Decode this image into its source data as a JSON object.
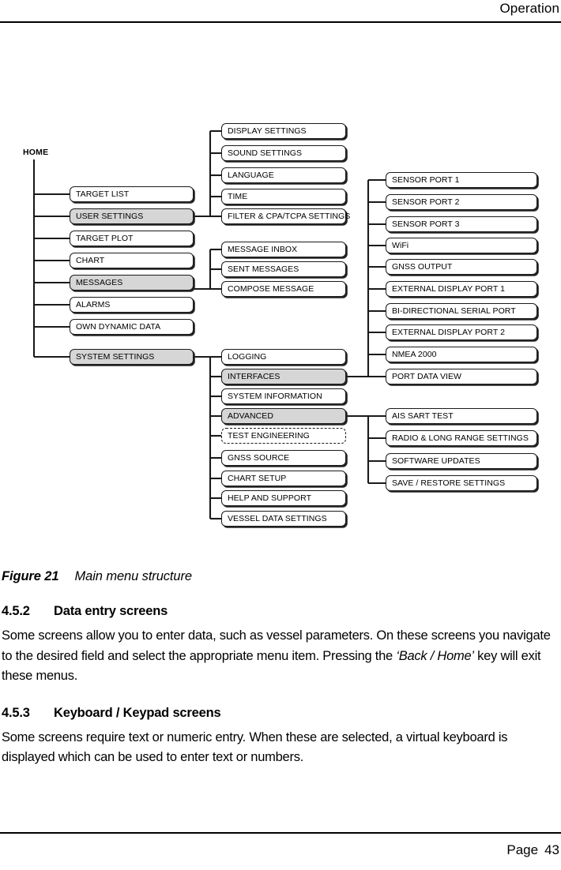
{
  "header": {
    "title": "Operation"
  },
  "footer": {
    "page_label": "Page",
    "page_number": "43"
  },
  "figure": {
    "label": "Figure 21",
    "title": "Main menu structure"
  },
  "diagram": {
    "root_label": "HOME",
    "columns": {
      "level1": [
        {
          "label": "TARGET LIST",
          "shaded": false
        },
        {
          "label": "USER SETTINGS",
          "shaded": true
        },
        {
          "label": "TARGET PLOT",
          "shaded": false
        },
        {
          "label": "CHART",
          "shaded": false
        },
        {
          "label": "MESSAGES",
          "shaded": true
        },
        {
          "label": "ALARMS",
          "shaded": false
        },
        {
          "label": "OWN DYNAMIC DATA",
          "shaded": false
        },
        {
          "label": "SYSTEM SETTINGS",
          "shaded": true
        }
      ],
      "user_settings_children": [
        {
          "label": "DISPLAY SETTINGS",
          "shaded": false
        },
        {
          "label": "SOUND SETTINGS",
          "shaded": false
        },
        {
          "label": "LANGUAGE",
          "shaded": false
        },
        {
          "label": "TIME",
          "shaded": false
        },
        {
          "label": "FILTER & CPA/TCPA SETTINGS",
          "shaded": false
        }
      ],
      "messages_children": [
        {
          "label": "MESSAGE INBOX",
          "shaded": false
        },
        {
          "label": "SENT MESSAGES",
          "shaded": false
        },
        {
          "label": "COMPOSE MESSAGE",
          "shaded": false
        }
      ],
      "system_settings_children": [
        {
          "label": "LOGGING",
          "shaded": false,
          "dashed": false
        },
        {
          "label": "INTERFACES",
          "shaded": true,
          "dashed": false
        },
        {
          "label": "SYSTEM INFORMATION",
          "shaded": false,
          "dashed": false
        },
        {
          "label": "ADVANCED",
          "shaded": true,
          "dashed": false
        },
        {
          "label": "TEST ENGINEERING",
          "shaded": false,
          "dashed": true
        },
        {
          "label": "GNSS SOURCE",
          "shaded": false,
          "dashed": false
        },
        {
          "label": "CHART SETUP",
          "shaded": false,
          "dashed": false
        },
        {
          "label": "HELP AND SUPPORT",
          "shaded": false,
          "dashed": false
        },
        {
          "label": "VESSEL DATA SETTINGS",
          "shaded": false,
          "dashed": false
        }
      ],
      "interfaces_children": [
        {
          "label": "SENSOR PORT 1",
          "shaded": false
        },
        {
          "label": "SENSOR PORT 2",
          "shaded": false
        },
        {
          "label": "SENSOR PORT 3",
          "shaded": false
        },
        {
          "label": "WiFi",
          "shaded": false
        },
        {
          "label": "GNSS OUTPUT",
          "shaded": false
        },
        {
          "label": "EXTERNAL DISPLAY PORT 1",
          "shaded": false
        },
        {
          "label": "BI-DIRECTIONAL SERIAL PORT",
          "shaded": false
        },
        {
          "label": "EXTERNAL DISPLAY PORT 2",
          "shaded": false
        },
        {
          "label": "NMEA 2000",
          "shaded": false
        },
        {
          "label": "PORT DATA VIEW",
          "shaded": false
        }
      ],
      "advanced_children": [
        {
          "label": "AIS SART TEST",
          "shaded": false
        },
        {
          "label": "RADIO & LONG RANGE SETTINGS",
          "shaded": false
        },
        {
          "label": "SOFTWARE UPDATES",
          "shaded": false
        },
        {
          "label": "SAVE / RESTORE SETTINGS",
          "shaded": false
        }
      ]
    }
  },
  "sections": [
    {
      "number": "4.5.2",
      "heading": "Data entry screens",
      "paragraph_parts": [
        {
          "text": "Some screens allow you to enter data, such as vessel parameters. On these screens you navigate to the desired field and select the appropriate menu item. Pressing the ",
          "italic": false
        },
        {
          "text": "‘Back / Home’",
          "italic": true
        },
        {
          "text": " key will exit these menus.",
          "italic": false
        }
      ]
    },
    {
      "number": "4.5.3",
      "heading": "Keyboard / Keypad screens",
      "paragraph_parts": [
        {
          "text": "Some screens require text or numeric entry. When these are selected, a virtual keyboard is displayed which can be used to enter text or numbers.",
          "italic": false
        }
      ]
    }
  ]
}
